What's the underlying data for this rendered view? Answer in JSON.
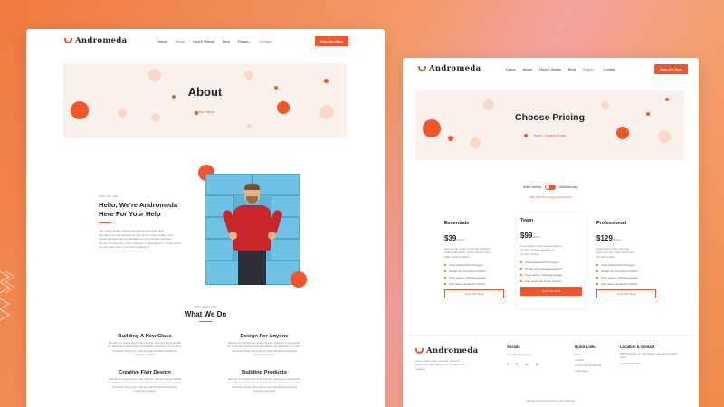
{
  "colors": {
    "accent": "#f0562a",
    "hero_bg": "#fbf1ec",
    "bg_orange": "#f07a3e"
  },
  "left": {
    "logo": "Andromeda",
    "menu": [
      "Home",
      "About",
      "How It Works",
      "Blog",
      "Pages",
      "Contact"
    ],
    "active_menu": "About",
    "signup": "Sign Up Now",
    "hero_title": "About",
    "crumb_home": "Home",
    "crumb_sep": " / ",
    "crumb_current": "About",
    "who_label": "WHO WE ARE",
    "headline_1": "Hello, We're Andromeda",
    "headline_2": "Here For Your Help",
    "intro_lines": [
      "Your online health & fitness companion that offers free",
      "assistance on all Facebook Groups and provides quality posts",
      "guided personal training packages as your through websites.",
      "We are the first ever, online marketers to distinguish in mobile phone",
      "you will select when you finish in getting fit."
    ],
    "services_label": "OUR SERVICES",
    "services_title": "What We Do",
    "services": [
      {
        "title": "Building A New Class",
        "lines": [
          "Decade of engineering under his belt, Jeremie is responsible",
          "for technical infrastructure and feature development. In Mind,",
          "wherever things can work & understanding developing",
          "complete solutions"
        ]
      },
      {
        "title": "Design For Anyone",
        "lines": [
          "Decade of engineering under his belt, Jeremie is responsible",
          "for technical infrastructure and feature development. In mind,",
          "wherever things can work & understanding developing",
          "complete solutions"
        ]
      },
      {
        "title": "Creative Flair Design",
        "lines": [
          "Decade of engineering under his belt, Jeremie is responsible",
          "for technical infrastructure and feature development. In Mind,",
          "wherever things can work & understanding developing",
          "complete solutions"
        ]
      },
      {
        "title": "Building Products",
        "lines": [
          "Decade of engineering under his belt, Jeremie is responsible",
          "for technical infrastructure and feature development. In mind,",
          "wherever things can work & understanding developing",
          "complete solutions"
        ]
      }
    ]
  },
  "right": {
    "logo": "Andromeda",
    "menu": [
      "Home",
      "About",
      "How It Works",
      "Blog",
      "Pages",
      "Contact"
    ],
    "active_menu": "Pages",
    "signup": "Sign Up Now",
    "hero_title": "Choose Pricing",
    "crumb_home": "Home",
    "crumb_sep": " / ",
    "crumb_current": "Choose Pricing",
    "billed_monthly": "Billed monthly",
    "billed_annually": "Billed annually",
    "save_text": "Save 50% On Annual Subscriptions",
    "plans": [
      {
        "name": "Essentials",
        "price": "$39",
        "per": "/Month",
        "desc": [
          "Nam ac elit a ante commodo tincidunt.",
          "Nullam bibendum, quam condimentum,",
          "ullam, euismod libero"
        ],
        "features": [
          "Track Related Plan Program",
          "Design and prototype powerful",
          "Keep work in unlimited storage",
          "Add people document himself"
        ],
        "button": "Grab This Deal",
        "featured": false
      },
      {
        "name": "Team",
        "price": "$99",
        "per": "/Month",
        "desc": [
          "Fusce vitae ornare sapien dapibus",
          "eu nibh, quisque pulvinar ut,",
          "ornare interdum"
        ],
        "features": [
          "Track Related Plan Program",
          "Design and prototype powerful",
          "Keep work in unlimited storage",
          "Add people document himself"
        ],
        "button": "Grab This Deal",
        "featured": true
      },
      {
        "name": "Professional",
        "price": "$129",
        "per": "/Month",
        "desc": [
          "Class aptent taciti sociosqu",
          "quis nunc nec, vitae scelerisque,",
          "vel auctor tellus"
        ],
        "features": [
          "Track Related Plan Program",
          "Design and prototype powerful",
          "Keep work in unlimited storage",
          "Add people document himself"
        ],
        "button": "Grab This Deal",
        "featured": false
      }
    ],
    "footer": {
      "about_lines": [
        "Lorem ipsum dolor sit amet, consect",
        "adipiscing. Odio tellus, sem condimentum",
        "molestie"
      ],
      "socials_title": "Socials",
      "socials_email": "hello@andromeda.io",
      "links_title": "Quick Links",
      "links": [
        "About",
        "Contact",
        "Terms And Conditions",
        "Changelog"
      ],
      "location_title": "Location & Contact",
      "location_lines": [
        "2058 Flambay Ct, Dominique Connecticut 6845",
        "office"
      ],
      "phone": "+1 754 550 0357",
      "credit": "Designed & Developed by ThemeWorks"
    }
  }
}
